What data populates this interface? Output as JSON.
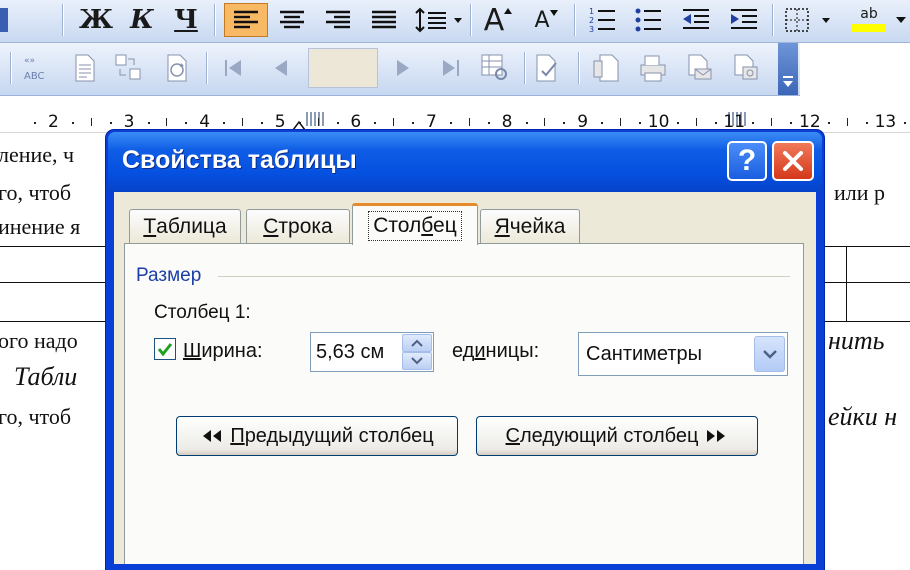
{
  "toolbar_format": {
    "buttons": [
      {
        "name": "bold-button",
        "glyph": "Ж"
      },
      {
        "name": "italic-button",
        "glyph": "К"
      },
      {
        "name": "underline-button",
        "glyph": "Ч"
      }
    ],
    "grow_font_glyph": "A",
    "shrink_font_glyph": "A",
    "highlight_glyph": "ab"
  },
  "ruler": {
    "numbers": [
      "2",
      "3",
      "4",
      "5",
      "6",
      "7",
      "8",
      "9",
      "10",
      "11",
      "12",
      "13"
    ]
  },
  "document": {
    "lines": [
      {
        "text": "ление, ч"
      },
      {
        "text": "го, чтоб"
      },
      {
        "text": "инение я"
      },
      {
        "text": "ого надо"
      },
      {
        "text": "Табли"
      },
      {
        "text": "го, чтоб"
      },
      {
        "text": "или р"
      },
      {
        "text": "нить"
      },
      {
        "text": "ейки н"
      }
    ]
  },
  "dialog": {
    "title": "Свойства таблицы",
    "help_glyph": "?",
    "tabs": [
      {
        "pre": "",
        "ul": "Т",
        "post": "аблица"
      },
      {
        "pre": "",
        "ul": "С",
        "post": "трока"
      },
      {
        "pre": "Стол",
        "ul": "б",
        "post": "ец"
      },
      {
        "pre": "",
        "ul": "Я",
        "post": "чейка"
      }
    ],
    "group_label": "Размер",
    "column_label": "Столбец 1:",
    "width": {
      "pre": "",
      "ul": "Ш",
      "post": "ирина:",
      "value": "5,63 см",
      "checked": true
    },
    "units": {
      "pre": "ед",
      "ul": "и",
      "post": "ницы:",
      "value": "Сантиметры"
    },
    "prev_button": {
      "pre": "",
      "ul": "П",
      "post": "редыдущий столбец"
    },
    "next_button": {
      "pre": "",
      "ul": "С",
      "post": "ледующий столбец"
    }
  },
  "colors": {
    "title_bar": "#0550e0",
    "close_button": "#d4381a",
    "dialog_face": "#ece9d8",
    "active_tab_accent": "#e68b2c",
    "toolbar": "#c9d9f1",
    "selected_button": "#f8b964"
  }
}
